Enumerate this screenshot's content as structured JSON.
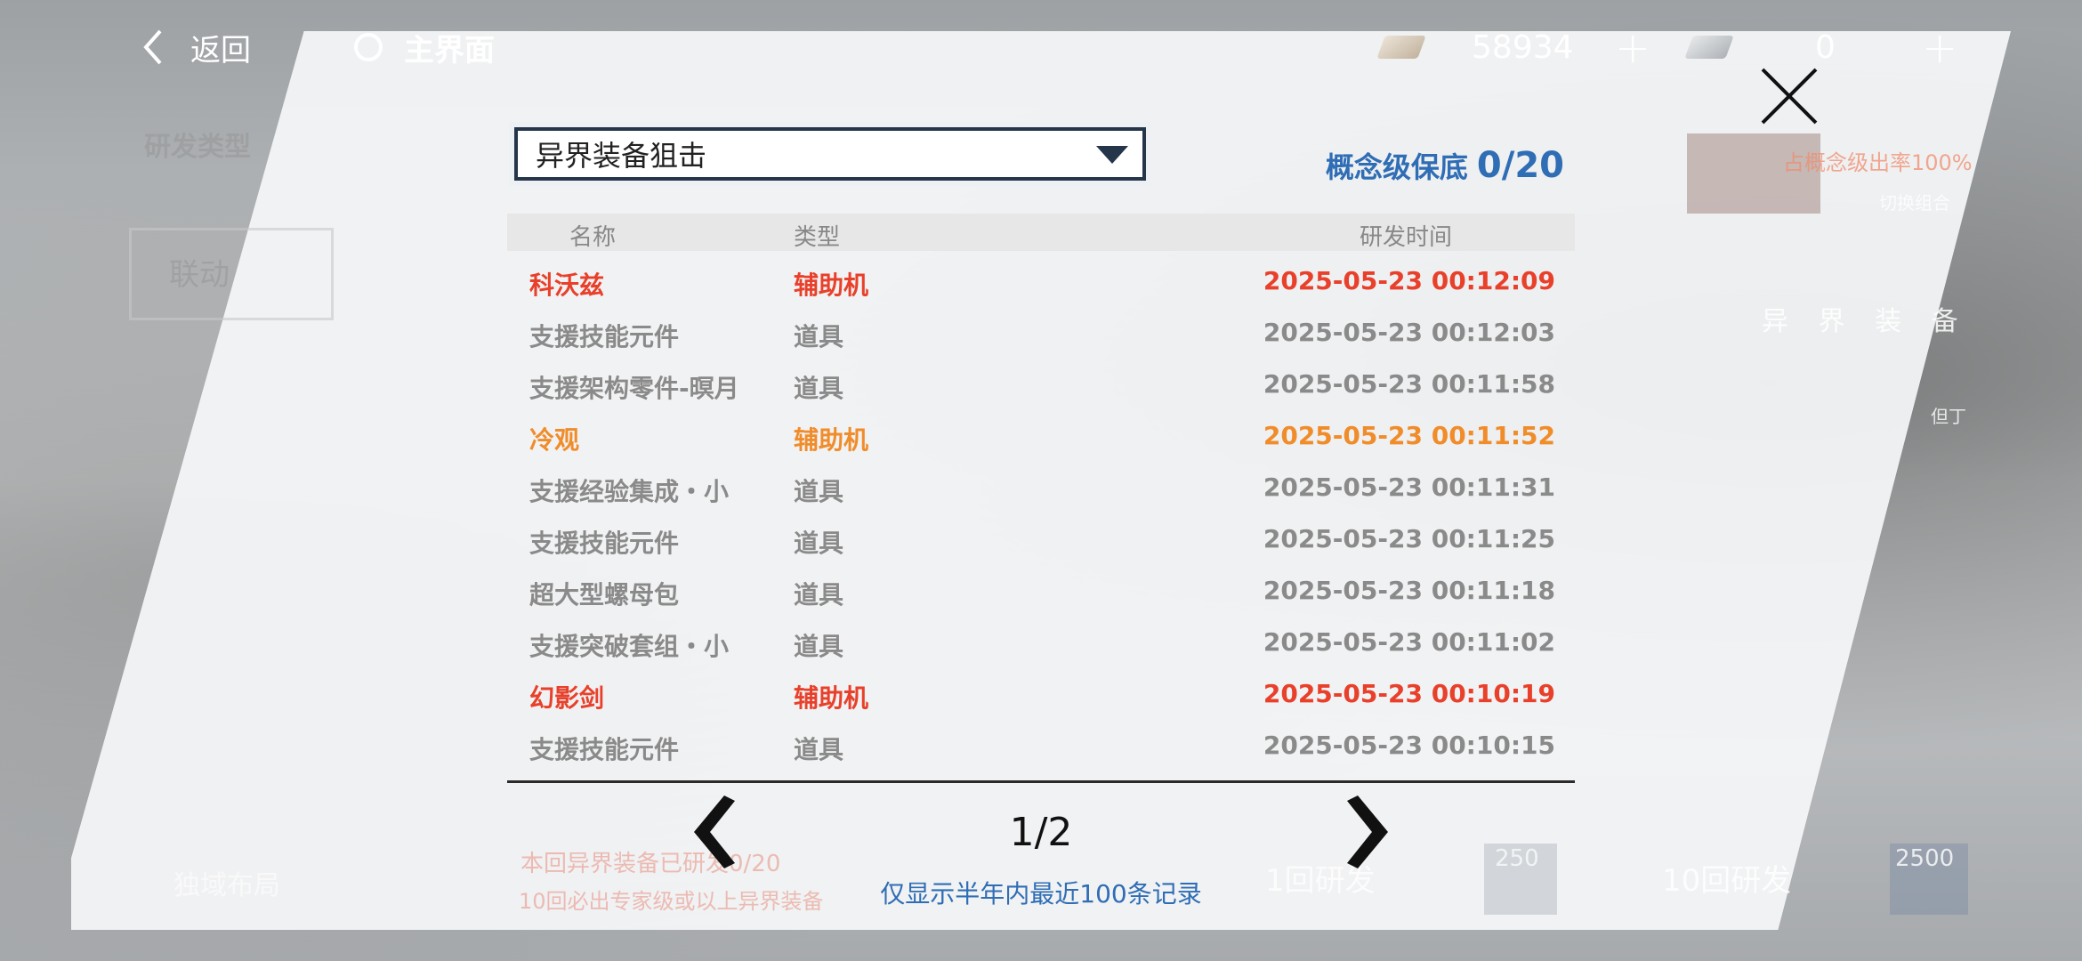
{
  "top_bar": {
    "back_label": "返回",
    "home_label": "主界面",
    "currency_1": {
      "value": "58934",
      "icon": "material-icon"
    },
    "currency_2": {
      "value": "0",
      "icon": "ticket-icon"
    },
    "plus_symbol": "+"
  },
  "background": {
    "dev_type_label": "研发类型",
    "collab_tab_label": "联动",
    "rate_up_text": "占概念级出率100%",
    "switch_combo_label": "切换组合",
    "category_label": "异 界 装 备",
    "char_tag": "但丁",
    "pull_1_label": "1回研发",
    "pull_1_cost": "250",
    "pull_10_label": "10回研发",
    "pull_10_cost": "2500",
    "guarantee_note": "本回异界装备已研发0/20",
    "ten_pull_note": "10回必出专家级或以上异界装备",
    "bottom_left_label": "独域布局"
  },
  "dialog": {
    "pool_select": {
      "selected": "异界装备狙击",
      "options_visible": [
        "异界装备狙击"
      ]
    },
    "guarantee_label": "概念级保底",
    "guarantee_value": "0/20",
    "columns": {
      "name": "名称",
      "type": "类型",
      "time": "研发时间"
    },
    "rows": [
      {
        "name": "科沃兹",
        "type": "辅助机",
        "time": "2025-05-23 00:12:09",
        "color": "#e8402a"
      },
      {
        "name": "支援技能元件",
        "type": "道具",
        "time": "2025-05-23 00:12:03",
        "color": "#8a8a8a"
      },
      {
        "name": "支援架构零件-暝月",
        "type": "道具",
        "time": "2025-05-23 00:11:58",
        "color": "#8a8a8a"
      },
      {
        "name": "冷观",
        "type": "辅助机",
        "time": "2025-05-23 00:11:52",
        "color": "#f08c2a"
      },
      {
        "name": "支援经验集成・小",
        "type": "道具",
        "time": "2025-05-23 00:11:31",
        "color": "#8a8a8a"
      },
      {
        "name": "支援技能元件",
        "type": "道具",
        "time": "2025-05-23 00:11:25",
        "color": "#8a8a8a"
      },
      {
        "name": "超大型螺母包",
        "type": "道具",
        "time": "2025-05-23 00:11:18",
        "color": "#8a8a8a"
      },
      {
        "name": "支援突破套组・小",
        "type": "道具",
        "time": "2025-05-23 00:11:02",
        "color": "#8a8a8a"
      },
      {
        "name": "幻影剑",
        "type": "辅助机",
        "time": "2025-05-23 00:10:19",
        "color": "#e8402a"
      },
      {
        "name": "支援技能元件",
        "type": "道具",
        "time": "2025-05-23 00:10:15",
        "color": "#8a8a8a"
      }
    ],
    "pagination": {
      "current": 1,
      "total": 2,
      "label": "1/2"
    },
    "note": "仅显示半年内最近100条记录"
  }
}
